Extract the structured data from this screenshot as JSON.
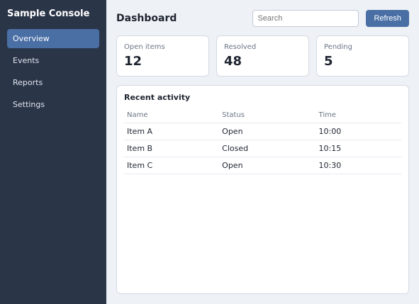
{
  "brand": "Sample Console",
  "nav": [
    "Overview",
    "Events",
    "Reports",
    "Settings"
  ],
  "title": "Dashboard",
  "search_placeholder": "Search",
  "refresh_label": "Refresh",
  "cards": [
    {
      "label": "Open items",
      "value": "12"
    },
    {
      "label": "Resolved",
      "value": "48"
    },
    {
      "label": "Pending",
      "value": "5"
    }
  ],
  "panel_title": "Recent activity",
  "columns": [
    "Name",
    "Status",
    "Time"
  ],
  "rows": [
    [
      "Item A",
      "Open",
      "10:00"
    ],
    [
      "Item B",
      "Closed",
      "10:15"
    ],
    [
      "Item C",
      "Open",
      "10:30"
    ]
  ]
}
